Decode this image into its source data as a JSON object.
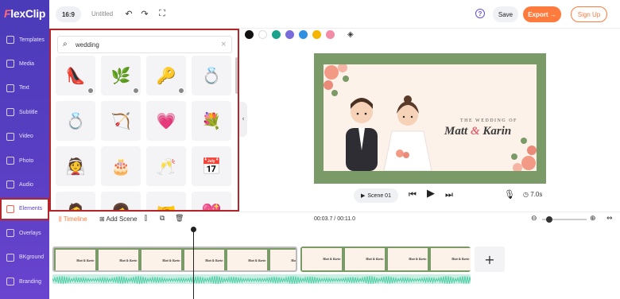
{
  "app": {
    "logo_text": "lexClip",
    "logo_f": "F"
  },
  "sidebar": {
    "items": [
      {
        "label": "Templates",
        "icon": "templates-icon"
      },
      {
        "label": "Media",
        "icon": "media-icon"
      },
      {
        "label": "Text",
        "icon": "text-icon"
      },
      {
        "label": "Subtitle",
        "icon": "subtitle-icon"
      },
      {
        "label": "Video",
        "icon": "video-icon"
      },
      {
        "label": "Photo",
        "icon": "photo-icon"
      },
      {
        "label": "Audio",
        "icon": "audio-icon"
      },
      {
        "label": "Elements",
        "icon": "elements-icon",
        "active": true
      },
      {
        "label": "Overlays",
        "icon": "overlays-icon"
      },
      {
        "label": "BKground",
        "icon": "background-icon"
      },
      {
        "label": "Branding",
        "icon": "branding-icon"
      }
    ]
  },
  "topbar": {
    "ratio": "16:9",
    "title": "Untitled",
    "help": "?",
    "save": "Save",
    "export": "Export →",
    "signup": "Sign Up"
  },
  "elements_panel": {
    "search_value": "wedding",
    "search_icon": "search-icon",
    "clear_icon": "close-icon",
    "items": [
      {
        "name": "glass-slipper",
        "glyph": "👠",
        "premium": true
      },
      {
        "name": "floral-arch",
        "glyph": "🌿",
        "premium": true
      },
      {
        "name": "love-key",
        "glyph": "🔑",
        "premium": true
      },
      {
        "name": "diamond-ring",
        "glyph": "💍",
        "premium": false
      },
      {
        "name": "gold-rings",
        "glyph": "💍",
        "premium": false
      },
      {
        "name": "cupid-bow",
        "glyph": "🏹",
        "premium": false
      },
      {
        "name": "winged-heart",
        "glyph": "💗",
        "premium": false
      },
      {
        "name": "rose-bouquet",
        "glyph": "💐",
        "premium": false
      },
      {
        "name": "wedding-dress",
        "glyph": "👰",
        "premium": false
      },
      {
        "name": "wedding-cake",
        "glyph": "🎂",
        "premium": false
      },
      {
        "name": "champagne-glasses",
        "glyph": "🥂",
        "premium": false
      },
      {
        "name": "love-calendar",
        "glyph": "📅",
        "premium": false
      },
      {
        "name": "groom",
        "glyph": "🤵",
        "premium": false
      },
      {
        "name": "bride",
        "glyph": "👩",
        "premium": false
      },
      {
        "name": "holding-hands",
        "glyph": "🤝",
        "premium": false
      },
      {
        "name": "heart-roses",
        "glyph": "💖",
        "premium": false
      }
    ]
  },
  "colors": [
    "#111111",
    "#ffffff",
    "#1aa38a",
    "#7a6bdc",
    "#2f8fe0",
    "#f5b400",
    "#f38aa6"
  ],
  "canvas": {
    "subtitle": "THE WEDDING OF",
    "name_a": "Matt",
    "amp": "&",
    "name_b": "Karin"
  },
  "playback": {
    "scene": "Scene 01",
    "duration": "7.0s"
  },
  "timeline": {
    "label": "Timeline",
    "add_scene": "Add Scene",
    "time": "00:03.7 / 00:11.0",
    "frame_text": "Matt & Karin"
  }
}
